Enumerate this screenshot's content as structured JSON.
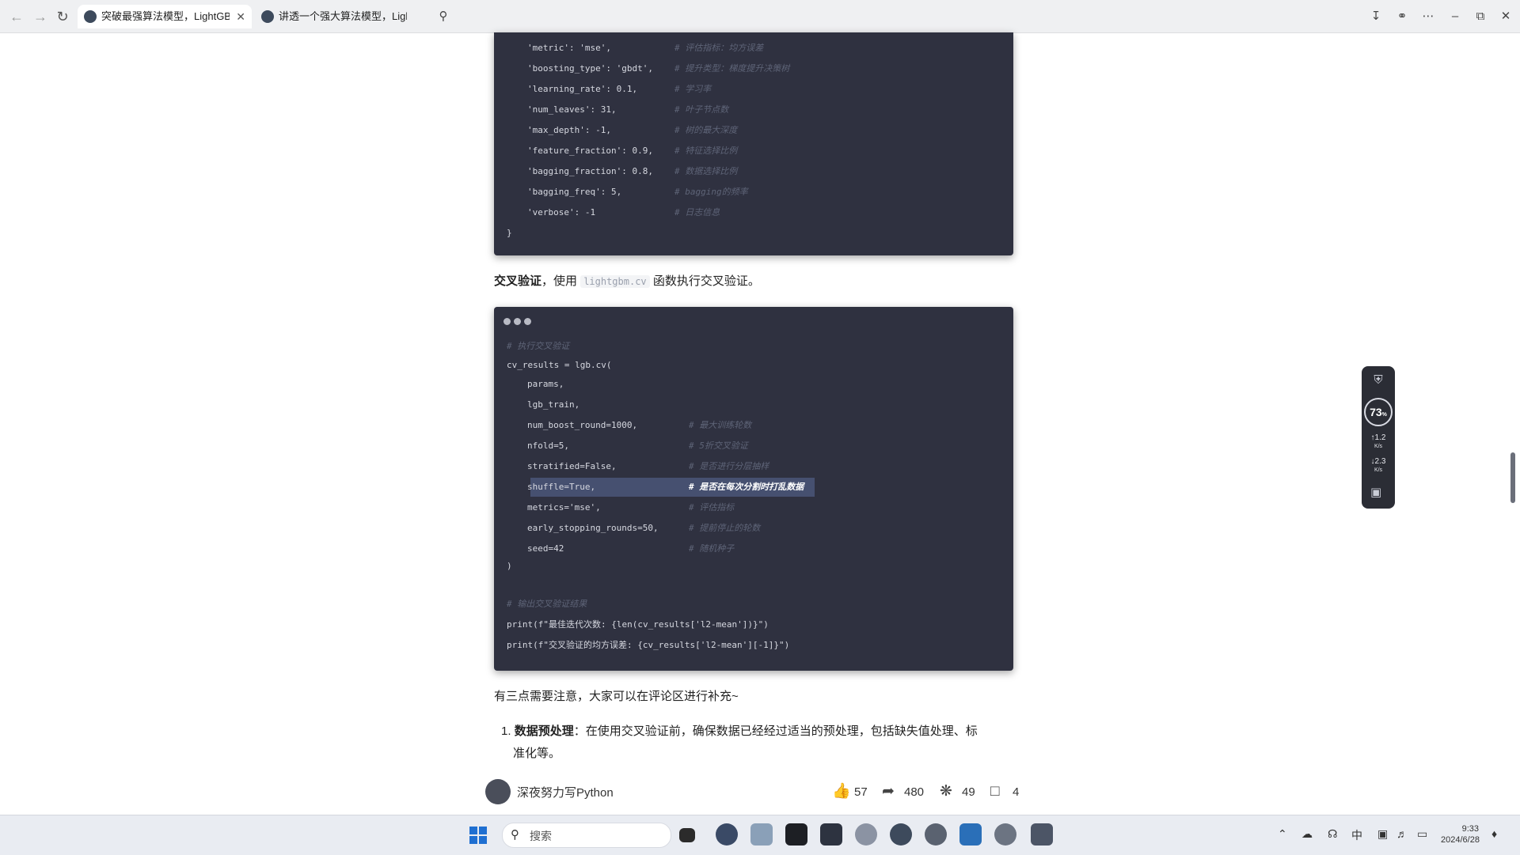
{
  "browser": {
    "tabs": [
      {
        "title": "突破最强算法模型，LightGBM",
        "active": true
      },
      {
        "title": "讲透一个强大算法模型，LightGBM",
        "active": false
      }
    ]
  },
  "code_block_1": {
    "lines": [
      {
        "code": "'metric': 'mse',",
        "comment": "# 评估指标：均方误差"
      },
      {
        "code": "'boosting_type': 'gbdt',",
        "comment": "# 提升类型：梯度提升决策树"
      },
      {
        "code": "'learning_rate': 0.1,",
        "comment": "# 学习率"
      },
      {
        "code": "'num_leaves': 31,",
        "comment": "# 叶子节点数"
      },
      {
        "code": "'max_depth': -1,",
        "comment": "# 树的最大深度"
      },
      {
        "code": "'feature_fraction': 0.9,",
        "comment": "# 特征选择比例"
      },
      {
        "code": "'bagging_fraction': 0.8,",
        "comment": "# 数据选择比例"
      },
      {
        "code": "'bagging_freq': 5,",
        "comment": "# bagging的频率"
      },
      {
        "code": "'verbose': -1",
        "comment": "# 日志信息"
      }
    ],
    "closing": "}"
  },
  "cv_heading": {
    "bold": "交叉验证",
    "before": "，使用 ",
    "code": "lightgbm.cv",
    "after": " 函数执行交叉验证。"
  },
  "code_block_2": {
    "top_comment": "# 执行交叉验证",
    "call": "cv_results = lgb.cv(",
    "args": [
      {
        "code": "params,",
        "comment": ""
      },
      {
        "code": "lgb_train,",
        "comment": ""
      },
      {
        "code": "num_boost_round=1000,",
        "comment": "# 最大训练轮数"
      },
      {
        "code": "nfold=5,",
        "comment": "# 5折交叉验证"
      },
      {
        "code": "stratified=False,",
        "comment": "# 是否进行分层抽样"
      },
      {
        "code": "shuffle=True,",
        "comment": "# 是否在每次分割时打乱数据"
      },
      {
        "code": "metrics='mse',",
        "comment": "# 评估指标"
      },
      {
        "code": "early_stopping_rounds=50,",
        "comment": "# 提前停止的轮数"
      },
      {
        "code": "seed=42",
        "comment": "# 随机种子"
      }
    ],
    "closing": ")",
    "output_comment": "# 输出交叉验证结果",
    "print1": "print(f\"最佳迭代次数: {len(cv_results['l2-mean'])}\")",
    "print2": "print(f\"交叉验证的均方误差: {cv_results['l2-mean'][-1]}\")"
  },
  "notice": "有三点需要注意，大家可以在评论区进行补充~",
  "list_item_1": {
    "number": "1.",
    "bold": "数据预处理",
    "text_line1": "：在使用交叉验证前，确保数据已经经过适当的预处理，包括缺失值处理、标",
    "text_line2": "准化等。"
  },
  "footer": {
    "author": "深夜努力写Python",
    "likes": "57",
    "shares": "480",
    "favorites": "49",
    "comments": "4"
  },
  "widget": {
    "percent": "73",
    "percent_unit": "%",
    "up_speed": "1.2",
    "up_unit": "K/s",
    "down_speed": "2.3",
    "down_unit": "K/s"
  },
  "taskbar": {
    "search_label": "搜索",
    "ime": "中",
    "time": "9:33",
    "date": "2024/6/28"
  },
  "colors": {
    "code_bg": "#2f3140",
    "highlight": "#465070",
    "accent": "#1f6fd1"
  }
}
